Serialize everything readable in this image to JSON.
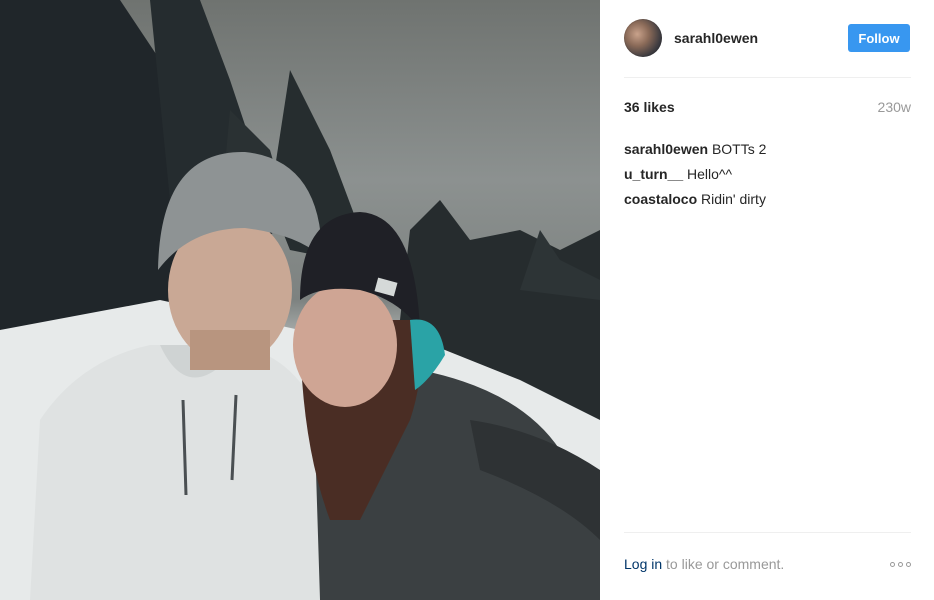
{
  "post": {
    "username": "sarahl0ewen",
    "follow_label": "Follow",
    "likes": "36 likes",
    "time": "230w",
    "comments": [
      {
        "author": "sarahl0ewen",
        "text": "BOTTs 2"
      },
      {
        "author": "u_turn__",
        "text": "Hello^^"
      },
      {
        "author": "coastaloco",
        "text": "Ridin' dirty"
      }
    ],
    "footer": {
      "login_label": "Log in",
      "rest_text": " to like or comment."
    },
    "icons": {
      "more": "more-options-icon",
      "avatar": "avatar"
    }
  },
  "colors": {
    "follow_button": "#3897f0",
    "link": "#003569",
    "muted": "#999999",
    "divider": "#efefef"
  }
}
